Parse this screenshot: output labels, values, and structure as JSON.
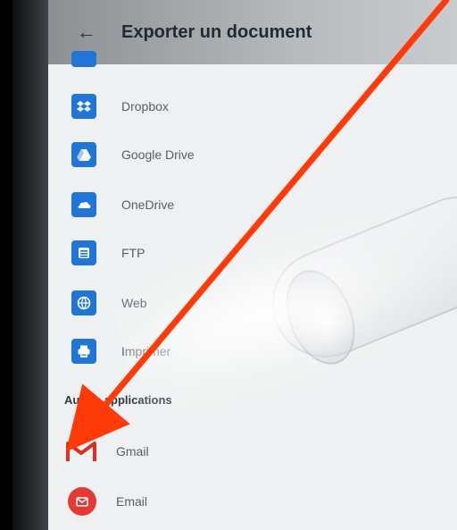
{
  "appbar": {
    "title": "Exporter un document",
    "back_icon": "arrow-left-icon"
  },
  "list": {
    "items": [
      {
        "label": "",
        "icon": "partial-top-icon",
        "color": "#1f76d6"
      },
      {
        "label": "Dropbox",
        "icon": "dropbox-icon",
        "color": "#1f76d6"
      },
      {
        "label": "Google Drive",
        "icon": "google-drive-icon",
        "color": "#1f76d6"
      },
      {
        "label": "OneDrive",
        "icon": "onedrive-icon",
        "color": "#1f76d6"
      },
      {
        "label": "FTP",
        "icon": "ftp-icon",
        "color": "#1f76d6"
      },
      {
        "label": "Web",
        "icon": "globe-icon",
        "color": "#1f76d6"
      },
      {
        "label": "Imprimer",
        "icon": "printer-icon",
        "color": "#1f76d6"
      }
    ]
  },
  "section": {
    "other_apps_title": "Autres applications",
    "apps": [
      {
        "label": "Gmail",
        "icon": "gmail-icon",
        "color": "#d93025"
      },
      {
        "label": "Email",
        "icon": "email-icon",
        "color": "#e53935"
      }
    ]
  },
  "annotation": {
    "arrow_color": "#ff3b0a"
  }
}
